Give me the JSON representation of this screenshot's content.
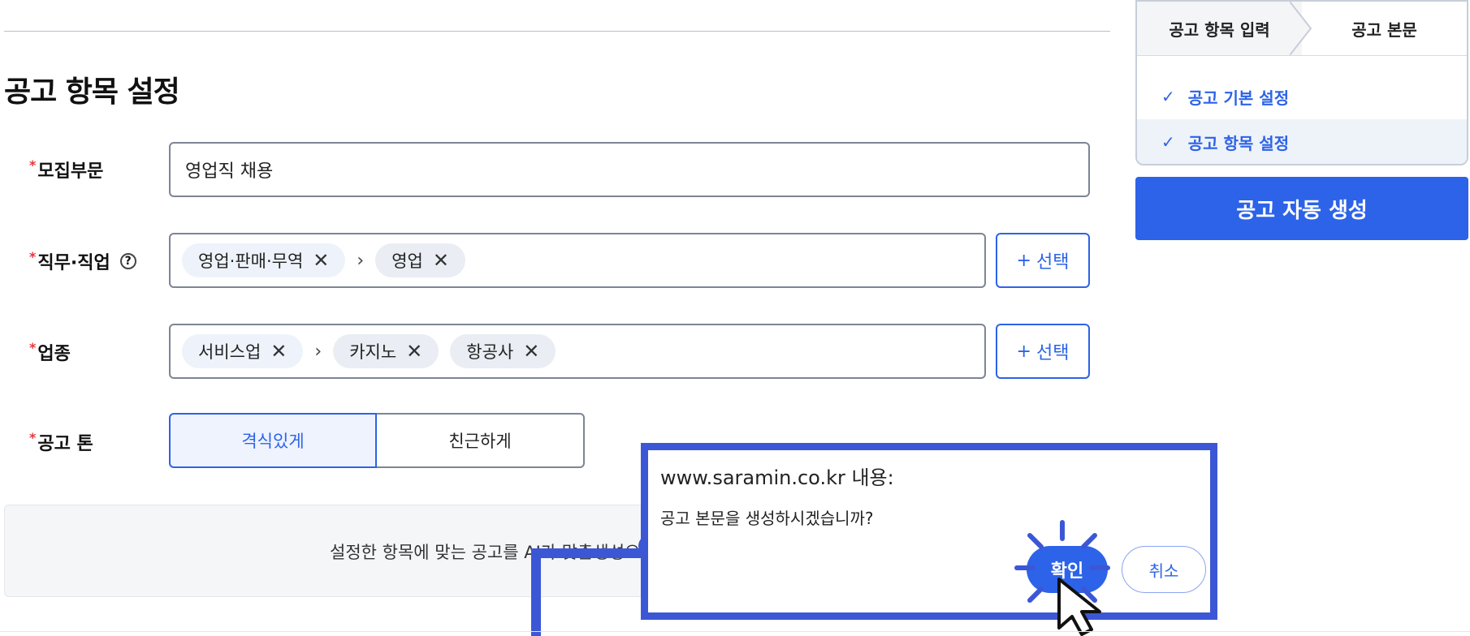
{
  "page": {
    "section_title": "공고 항목 설정"
  },
  "form": {
    "recruit_division": {
      "label": "모집부문",
      "value": "영업직 채용"
    },
    "job": {
      "label": "직무·직업",
      "chips": [
        "영업·판매·무역",
        "영업"
      ],
      "select_label": "선택"
    },
    "industry": {
      "label": "업종",
      "chips": [
        "서비스업",
        "카지노",
        "항공사"
      ],
      "select_label": "선택"
    },
    "tone": {
      "label": "공고 톤",
      "options": [
        "격식있게",
        "친근하게"
      ],
      "selected": "격식있게"
    },
    "info_text": "설정한 항목에 맞는 공고를 AI가 맞춤생성으로"
  },
  "stepper": {
    "tabs": [
      "공고 항목 입력",
      "공고 본문"
    ],
    "steps": [
      "공고 기본 설정",
      "공고 항목 설정"
    ],
    "generate_label": "공고 자동 생성"
  },
  "dialog": {
    "title": "www.saramin.co.kr 내용:",
    "message": "공고 본문을 생성하시겠습니까?",
    "ok_label": "확인",
    "cancel_label": "취소"
  },
  "icons": {
    "help": "question-circle-icon",
    "remove": "close-icon",
    "separator": "chevron-right-icon",
    "add": "plus-icon",
    "check": "check-icon"
  },
  "colors": {
    "accent": "#2d63e8",
    "required": "#e8353a",
    "annotation": "#3c57d6"
  }
}
